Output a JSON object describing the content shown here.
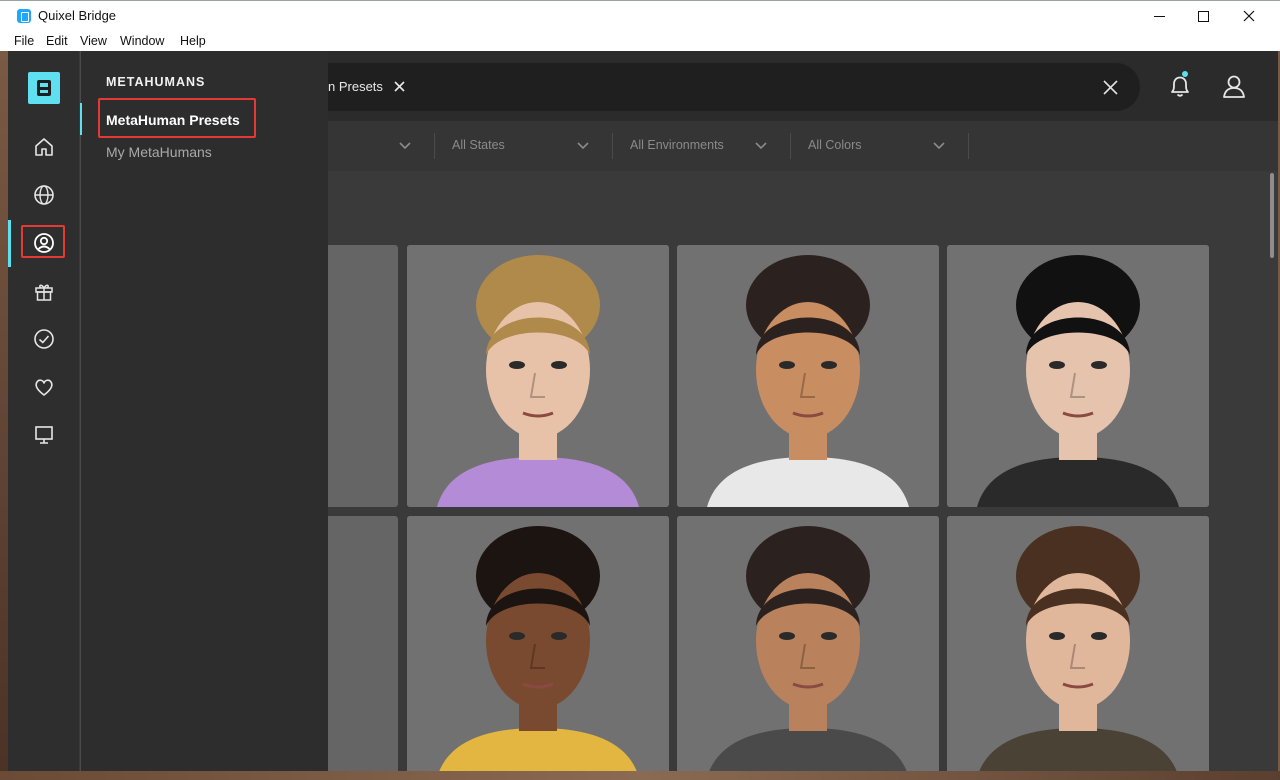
{
  "window": {
    "title": "Quixel Bridge",
    "menu": [
      "File",
      "Edit",
      "View",
      "Window",
      "Help"
    ]
  },
  "rail": {
    "icons": [
      "home-icon",
      "globe-icon",
      "metahuman-icon",
      "gift-icon",
      "check-circle-icon",
      "heart-icon",
      "monitor-icon"
    ],
    "active": "metahuman-icon",
    "accent_color": "#5ee0f0"
  },
  "subpanel": {
    "heading": "METAHUMANS",
    "items": [
      "MetaHuman Presets",
      "My MetaHumans"
    ],
    "active_item": "MetaHuman Presets"
  },
  "search": {
    "chip_label": "n Presets"
  },
  "filters": [
    "All States",
    "All Environments",
    "All Colors"
  ],
  "presets": [
    {
      "hair": "#b08a4a",
      "skin": "#e8c2a8",
      "top": "#b48bd6",
      "label": "preset-blonde-woman"
    },
    {
      "hair": "#2b2220",
      "skin": "#c98d62",
      "top": "#e8e8e8",
      "label": "preset-bearded-man"
    },
    {
      "hair": "#111111",
      "skin": "#e6c3ad",
      "top": "#2a2a2a",
      "label": "preset-dark-hair-woman"
    },
    {
      "hair": "#1b1410",
      "skin": "#7a4a30",
      "top": "#e2b640",
      "label": "preset-young-man"
    },
    {
      "hair": "#2b2220",
      "skin": "#b9825c",
      "top": "#4a4a4a",
      "label": "preset-man-bun"
    },
    {
      "hair": "#4a3020",
      "skin": "#e1b79c",
      "top": "#4b4236",
      "label": "preset-older-man"
    }
  ],
  "colors": {
    "highlight": "#e53935"
  }
}
